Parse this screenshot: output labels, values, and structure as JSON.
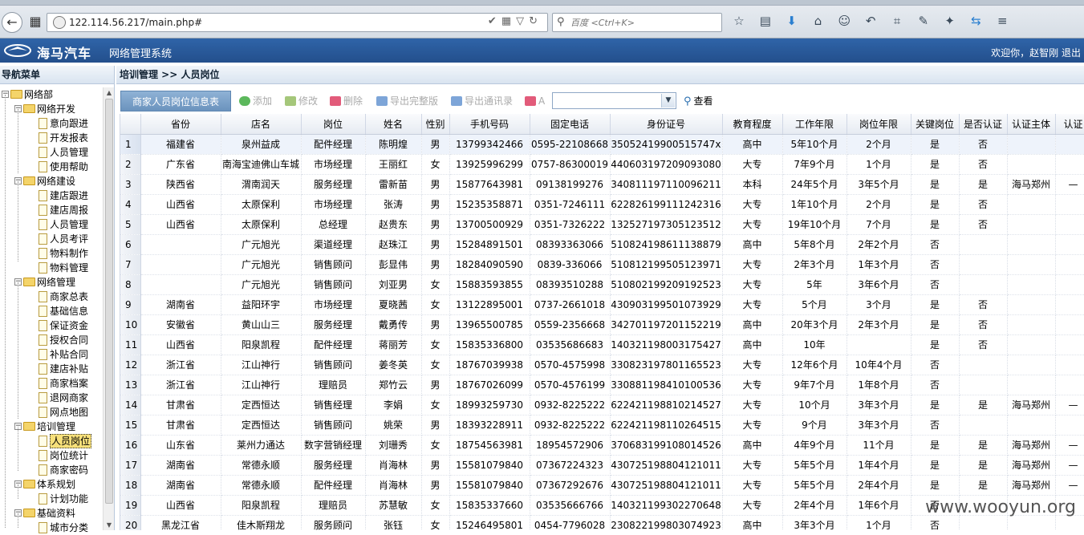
{
  "browser": {
    "url": "122.114.56.217/main.php#",
    "search_placeholder": "百度 <Ctrl+K>"
  },
  "header": {
    "brand": "海马汽车",
    "system_title": "网络管理系统",
    "welcome": "欢迎你，赵智刚 退出"
  },
  "sidebar": {
    "title": "导航菜单",
    "tree": [
      {
        "label": "网络部",
        "level": 0,
        "type": "folder"
      },
      {
        "label": "网络开发",
        "level": 1,
        "type": "folder"
      },
      {
        "label": "意向跟进",
        "level": 2,
        "type": "doc"
      },
      {
        "label": "开发报表",
        "level": 2,
        "type": "doc"
      },
      {
        "label": "人员管理",
        "level": 2,
        "type": "doc"
      },
      {
        "label": "使用帮助",
        "level": 2,
        "type": "doc"
      },
      {
        "label": "网络建设",
        "level": 1,
        "type": "folder"
      },
      {
        "label": "建店跟进",
        "level": 2,
        "type": "doc"
      },
      {
        "label": "建店周报",
        "level": 2,
        "type": "doc"
      },
      {
        "label": "人员管理",
        "level": 2,
        "type": "doc"
      },
      {
        "label": "人员考评",
        "level": 2,
        "type": "doc"
      },
      {
        "label": "物料制作",
        "level": 2,
        "type": "doc"
      },
      {
        "label": "物料管理",
        "level": 2,
        "type": "doc"
      },
      {
        "label": "网络管理",
        "level": 1,
        "type": "folder"
      },
      {
        "label": "商家总表",
        "level": 2,
        "type": "doc"
      },
      {
        "label": "基础信息",
        "level": 2,
        "type": "doc"
      },
      {
        "label": "保证资金",
        "level": 2,
        "type": "doc"
      },
      {
        "label": "授权合同",
        "level": 2,
        "type": "doc"
      },
      {
        "label": "补贴合同",
        "level": 2,
        "type": "doc"
      },
      {
        "label": "建店补贴",
        "level": 2,
        "type": "doc"
      },
      {
        "label": "商家档案",
        "level": 2,
        "type": "doc"
      },
      {
        "label": "退网商家",
        "level": 2,
        "type": "doc"
      },
      {
        "label": "网点地图",
        "level": 2,
        "type": "doc"
      },
      {
        "label": "培训管理",
        "level": 1,
        "type": "folder"
      },
      {
        "label": "人员岗位",
        "level": 2,
        "type": "doc",
        "selected": true
      },
      {
        "label": "岗位统计",
        "level": 2,
        "type": "doc"
      },
      {
        "label": "商家密码",
        "level": 2,
        "type": "doc"
      },
      {
        "label": "体系规划",
        "level": 1,
        "type": "folder"
      },
      {
        "label": "计划功能",
        "level": 2,
        "type": "doc"
      },
      {
        "label": "基础资料",
        "level": 1,
        "type": "folder"
      },
      {
        "label": "城市分类",
        "level": 2,
        "type": "doc"
      }
    ]
  },
  "main": {
    "breadcrumb": "培训管理 >> 人员岗位",
    "panel_title": "商家人员岗位信息表",
    "toolbar": {
      "add": "添加",
      "edit": "修改",
      "delete": "删除",
      "export_full": "导出完整版",
      "export_contacts": "导出通讯录",
      "filter_label": "A",
      "filter_value": "",
      "view": "查看"
    },
    "table": {
      "columns": [
        "",
        "省份",
        "店名",
        "岗位",
        "姓名",
        "性别",
        "手机号码",
        "固定电话",
        "身份证号",
        "教育程度",
        "工作年限",
        "岗位年限",
        "关键岗位",
        "是否认证",
        "认证主体",
        "认证"
      ],
      "rows": [
        [
          "1",
          "福建省",
          "泉州益成",
          "配件经理",
          "陈明煌",
          "男",
          "13799342466",
          "0595-22108668",
          "35052419900515747x",
          "高中",
          "5年10个月",
          "2个月",
          "是",
          "否",
          "",
          ""
        ],
        [
          "2",
          "广东省",
          "南海宝迪佛山车城",
          "市场经理",
          "王丽红",
          "女",
          "13925996299",
          "0757-86300019",
          "440603197209093080",
          "大专",
          "7年9个月",
          "1个月",
          "是",
          "否",
          "",
          ""
        ],
        [
          "3",
          "陕西省",
          "渭南润天",
          "服务经理",
          "雷新苗",
          "男",
          "15877643981",
          "09138199276",
          "340811197110096211",
          "本科",
          "24年5个月",
          "3年5个月",
          "是",
          "是",
          "海马郑州",
          "—"
        ],
        [
          "4",
          "山西省",
          "太原保利",
          "市场经理",
          "张涛",
          "男",
          "15235358871",
          "0351-7246111",
          "622826199111242316",
          "大专",
          "1年10个月",
          "2个月",
          "是",
          "否",
          "",
          ""
        ],
        [
          "5",
          "山西省",
          "太原保利",
          "总经理",
          "赵贵东",
          "男",
          "13700500929",
          "0351-7326222",
          "132527197305123512",
          "大专",
          "19年10个月",
          "7个月",
          "是",
          "否",
          "",
          ""
        ],
        [
          "6",
          "",
          "广元旭光",
          "渠道经理",
          "赵珠江",
          "男",
          "15284891501",
          "08393363066",
          "510824198611138879",
          "高中",
          "5年8个月",
          "2年2个月",
          "否",
          "",
          "",
          ""
        ],
        [
          "7",
          "",
          "广元旭光",
          "销售顾问",
          "彭显伟",
          "男",
          "18284090590",
          "0839-336066",
          "510812199505123971",
          "大专",
          "2年3个月",
          "1年3个月",
          "否",
          "",
          "",
          ""
        ],
        [
          "8",
          "",
          "广元旭光",
          "销售顾问",
          "刘亚男",
          "女",
          "15883593855",
          "08393510288",
          "510802199209192523",
          "大专",
          "5年",
          "3年6个月",
          "否",
          "",
          "",
          ""
        ],
        [
          "9",
          "湖南省",
          "益阳环宇",
          "市场经理",
          "夏晓茜",
          "女",
          "13122895001",
          "0737-2661018",
          "430903199501073929",
          "大专",
          "5个月",
          "3个月",
          "是",
          "否",
          "",
          ""
        ],
        [
          "10",
          "安徽省",
          "黄山山三",
          "服务经理",
          "戴勇传",
          "男",
          "13965500785",
          "0559-2356668",
          "342701197201152219",
          "高中",
          "20年3个月",
          "2年3个月",
          "是",
          "否",
          "",
          ""
        ],
        [
          "11",
          "山西省",
          "阳泉凯程",
          "配件经理",
          "蒋丽芳",
          "女",
          "15835336800",
          "03535686683",
          "140321198003175427",
          "高中",
          "10年",
          "",
          "是",
          "否",
          "",
          ""
        ],
        [
          "12",
          "浙江省",
          "江山神行",
          "销售顾问",
          "姜冬英",
          "女",
          "18767039938",
          "0570-4575998",
          "330823197801165523",
          "大专",
          "12年6个月",
          "10年4个月",
          "否",
          "",
          "",
          ""
        ],
        [
          "13",
          "浙江省",
          "江山神行",
          "理赔员",
          "郑竹云",
          "男",
          "18767026099",
          "0570-4576199",
          "330881198410100536",
          "大专",
          "9年7个月",
          "1年8个月",
          "否",
          "",
          "",
          ""
        ],
        [
          "14",
          "甘肃省",
          "定西恒达",
          "销售经理",
          "李娟",
          "女",
          "18993259730",
          "0932-8225222",
          "622421198810214527",
          "大专",
          "10个月",
          "3年3个月",
          "是",
          "是",
          "海马郑州",
          "—"
        ],
        [
          "15",
          "甘肃省",
          "定西恒达",
          "销售顾问",
          "姚荣",
          "男",
          "18393228911",
          "0932-8225222",
          "622421198110264515",
          "大专",
          "9个月",
          "3年3个月",
          "否",
          "",
          "",
          ""
        ],
        [
          "16",
          "山东省",
          "莱州力通达",
          "数字营销经理",
          "刘珊秀",
          "女",
          "18754563981",
          "18954572906",
          "370683199108014526",
          "高中",
          "4年9个月",
          "11个月",
          "是",
          "是",
          "海马郑州",
          "—"
        ],
        [
          "17",
          "湖南省",
          "常德永顺",
          "服务经理",
          "肖海林",
          "男",
          "15581079840",
          "07367224323",
          "430725198804121011",
          "大专",
          "5年5个月",
          "1年4个月",
          "是",
          "是",
          "海马郑州",
          "—"
        ],
        [
          "18",
          "湖南省",
          "常德永顺",
          "配件经理",
          "肖海林",
          "男",
          "15581079840",
          "07367292676",
          "430725198804121011",
          "大专",
          "5年5个月",
          "2年4个月",
          "是",
          "是",
          "海马郑州",
          "—"
        ],
        [
          "19",
          "山西省",
          "阳泉凯程",
          "理赔员",
          "苏慧敏",
          "女",
          "15835337660",
          "03535666766",
          "140321199302270648",
          "大专",
          "2年4个月",
          "1年6个月",
          "否",
          "",
          "",
          ""
        ],
        [
          "20",
          "黑龙江省",
          "佳木斯翔龙",
          "服务顾问",
          "张钰",
          "女",
          "15246495801",
          "0454-7796028",
          "230822199803074923",
          "高中",
          "3年3个月",
          "1个月",
          "否",
          "",
          "",
          ""
        ]
      ]
    }
  },
  "watermark": "www.wooyun.org"
}
